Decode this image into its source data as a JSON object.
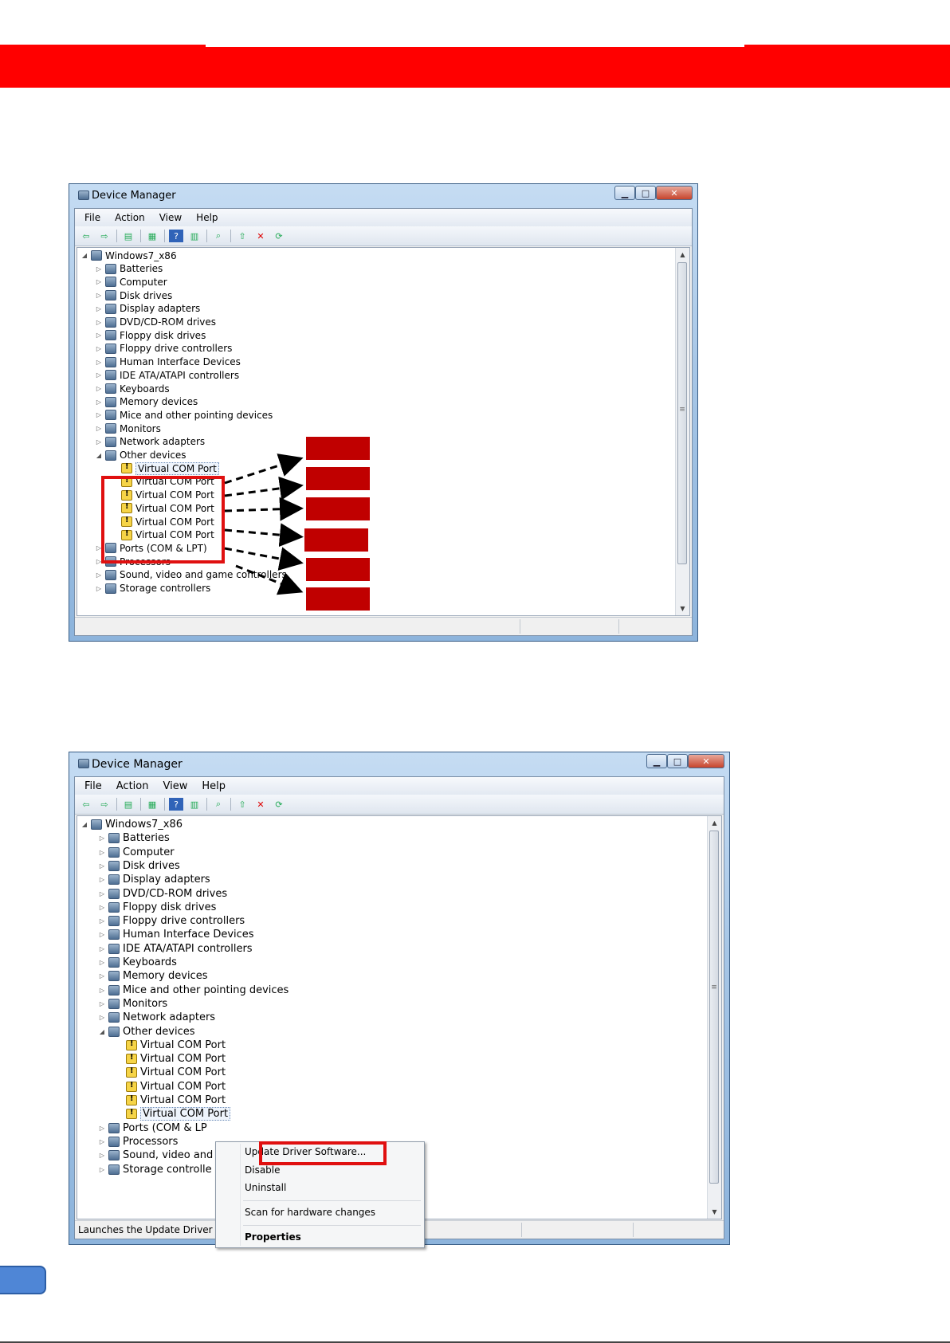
{
  "colors": {
    "banner": "#ff0000",
    "highlight": "#e01010",
    "placeholder_box": "#c00000",
    "tab": "#4f86d6"
  },
  "window1": {
    "title": "Device Manager",
    "menu": [
      "File",
      "Action",
      "View",
      "Help"
    ],
    "toolbar_icons": [
      "back-icon",
      "forward-icon",
      "sep",
      "console-tree-icon",
      "sep",
      "properties-icon",
      "sep",
      "help-icon",
      "action-pane-icon",
      "sep",
      "scan-hardware-icon",
      "sep",
      "update-driver-icon",
      "uninstall-icon",
      "enable-icon"
    ],
    "root": "Windows7_x86",
    "categories": [
      "Batteries",
      "Computer",
      "Disk drives",
      "Display adapters",
      "DVD/CD-ROM drives",
      "Floppy disk drives",
      "Floppy drive controllers",
      "Human Interface Devices",
      "IDE ATA/ATAPI controllers",
      "Keyboards",
      "Memory devices",
      "Mice and other pointing devices",
      "Monitors",
      "Network adapters",
      "Other devices"
    ],
    "other_devices": [
      "Virtual COM Port",
      "Virtual COM Port",
      "Virtual COM Port",
      "Virtual COM Port",
      "Virtual COM Port",
      "Virtual COM Port"
    ],
    "after": [
      "Ports (COM & LPT)",
      "Processors",
      "Sound, video and game controllers",
      "Storage controllers"
    ]
  },
  "window2": {
    "title": "Device Manager",
    "menu": [
      "File",
      "Action",
      "View",
      "Help"
    ],
    "root": "Windows7_x86",
    "categories": [
      "Batteries",
      "Computer",
      "Disk drives",
      "Display adapters",
      "DVD/CD-ROM drives",
      "Floppy disk drives",
      "Floppy drive controllers",
      "Human Interface Devices",
      "IDE ATA/ATAPI controllers",
      "Keyboards",
      "Memory devices",
      "Mice and other pointing devices",
      "Monitors",
      "Network adapters",
      "Other devices"
    ],
    "other_devices": [
      "Virtual COM Port",
      "Virtual COM Port",
      "Virtual COM Port",
      "Virtual COM Port",
      "Virtual COM Port",
      "Virtual COM Port"
    ],
    "after": [
      "Ports (COM & LP",
      "Processors",
      "Sound, video and",
      "Storage controlle"
    ],
    "status": "Launches the Update Driver S",
    "context_menu": {
      "update": "Update Driver Software...",
      "disable": "Disable",
      "uninstall": "Uninstall",
      "scan": "Scan for hardware changes",
      "properties": "Properties"
    }
  }
}
